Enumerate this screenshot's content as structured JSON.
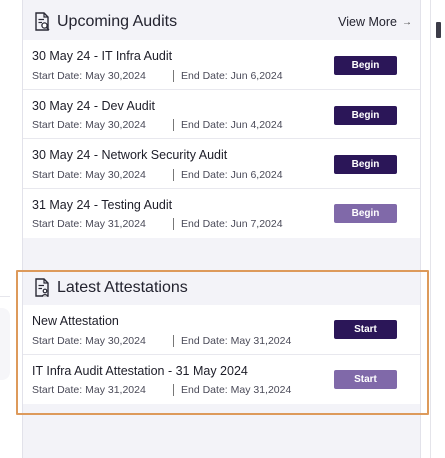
{
  "colors": {
    "button_dark": "#2b1658",
    "button_light": "#8069a9",
    "highlight_border": "#dd9a5b",
    "panel_bg": "#f3f3f8"
  },
  "upcoming_audits": {
    "title": "Upcoming Audits",
    "icon": "document-search-icon",
    "view_more": "View More",
    "view_more_icon": "arrow-right-icon",
    "arrow_glyph": "→",
    "items": [
      {
        "title": "30 May 24 - IT Infra Audit",
        "start": "Start Date: May 30,2024",
        "end": "End Date: Jun 6,2024",
        "button": "Begin",
        "style": "dark"
      },
      {
        "title": "30 May 24 - Dev Audit",
        "start": "Start Date: May 30,2024",
        "end": "End Date: Jun 4,2024",
        "button": "Begin",
        "style": "dark"
      },
      {
        "title": "30 May 24 - Network Security Audit",
        "start": "Start Date: May 30,2024",
        "end": "End Date: Jun 6,2024",
        "button": "Begin",
        "style": "dark"
      },
      {
        "title": "31 May 24 - Testing Audit",
        "start": "Start Date: May 31,2024",
        "end": "End Date: Jun 7,2024",
        "button": "Begin",
        "style": "light"
      }
    ]
  },
  "latest_attestations": {
    "title": "Latest Attestations",
    "icon": "document-user-icon",
    "items": [
      {
        "title": "New Attestation",
        "start": "Start Date: May 30,2024",
        "end": "End Date: May 31,2024",
        "button": "Start",
        "style": "dark"
      },
      {
        "title": "IT Infra Audit Attestation - 31 May 2024",
        "start": "Start Date: May 31,2024",
        "end": "End Date: May 31,2024",
        "button": "Start",
        "style": "light"
      }
    ]
  }
}
